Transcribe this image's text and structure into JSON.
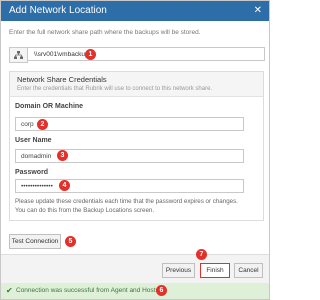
{
  "dialog": {
    "title": "Add Network Location",
    "close_icon": "close-icon",
    "intro": "Enter the full network share path where the backups will be stored."
  },
  "path": {
    "icon": "network-share-icon",
    "value": "\\\\srv001\\vmbackup"
  },
  "credentials": {
    "heading": "Network Share Credentials",
    "subheading": "Enter the credentials that Rubrik will use to connect to this network share.",
    "domain_label": "Domain OR Machine",
    "domain_value": "corp",
    "user_label": "User Name",
    "user_value": "domadmin",
    "password_label": "Password",
    "password_value": "••••••••••••••",
    "note": "Please update these credentials each time that the password expires or changes. You can do this from the Backup Locations screen."
  },
  "buttons": {
    "test_connection": "Test Connection",
    "previous": "Previous",
    "finish": "Finish",
    "cancel": "Cancel"
  },
  "status": {
    "icon": "check-icon",
    "message": "Connection was successful from Agent and Hosts"
  },
  "badges": [
    "1",
    "2",
    "3",
    "4",
    "5",
    "6",
    "7"
  ],
  "colors": {
    "title_bar": "#2d6da8",
    "badge": "#e2302a",
    "success_bg": "#dff0d8",
    "success_text": "#3c763d",
    "highlight_outline": "#e2302a"
  }
}
